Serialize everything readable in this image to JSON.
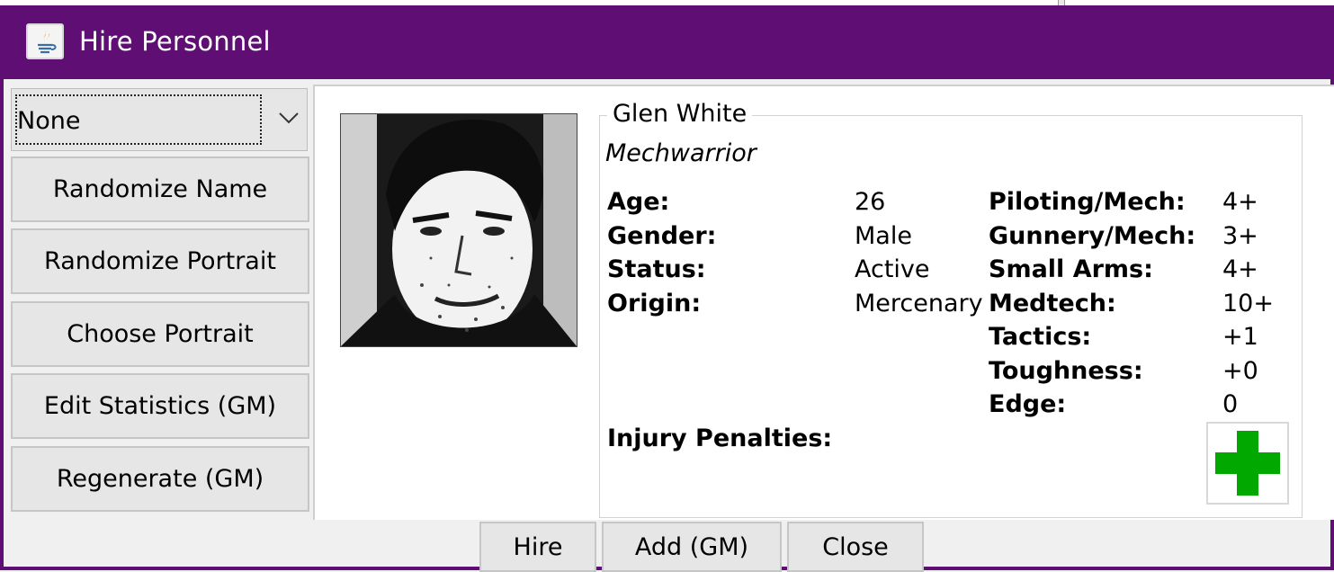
{
  "window": {
    "title": "Hire Personnel"
  },
  "left_panel": {
    "combo_value": "None",
    "buttons": [
      "Randomize Name",
      "Randomize Portrait",
      "Choose Portrait",
      "Edit Statistics (GM)",
      "Regenerate (GM)"
    ]
  },
  "person": {
    "name": "Glen White",
    "role": "Mechwarrior",
    "age_label": "Age:",
    "age": "26",
    "gender_label": "Gender:",
    "gender": "Male",
    "status_label": "Status:",
    "status": "Active",
    "origin_label": "Origin:",
    "origin": "Mercenary",
    "injury_label": "Injury Penalties:"
  },
  "skills": [
    {
      "label": "Piloting/Mech:",
      "value": "4+"
    },
    {
      "label": "Gunnery/Mech:",
      "value": "3+"
    },
    {
      "label": "Small Arms:",
      "value": "4+"
    },
    {
      "label": "Medtech:",
      "value": "10+"
    },
    {
      "label": "Tactics:",
      "value": "+1"
    },
    {
      "label": "Toughness:",
      "value": "+0"
    },
    {
      "label": "Edge:",
      "value": "0"
    }
  ],
  "bottom": {
    "hire": "Hire",
    "add_gm": "Add (GM)",
    "close": "Close"
  },
  "colors": {
    "titlebar": "#5f0f73",
    "medical_plus": "#00a800"
  },
  "icons": {
    "app": "java-icon",
    "combo": "chevron-down-icon",
    "medical": "medical-plus-icon"
  }
}
